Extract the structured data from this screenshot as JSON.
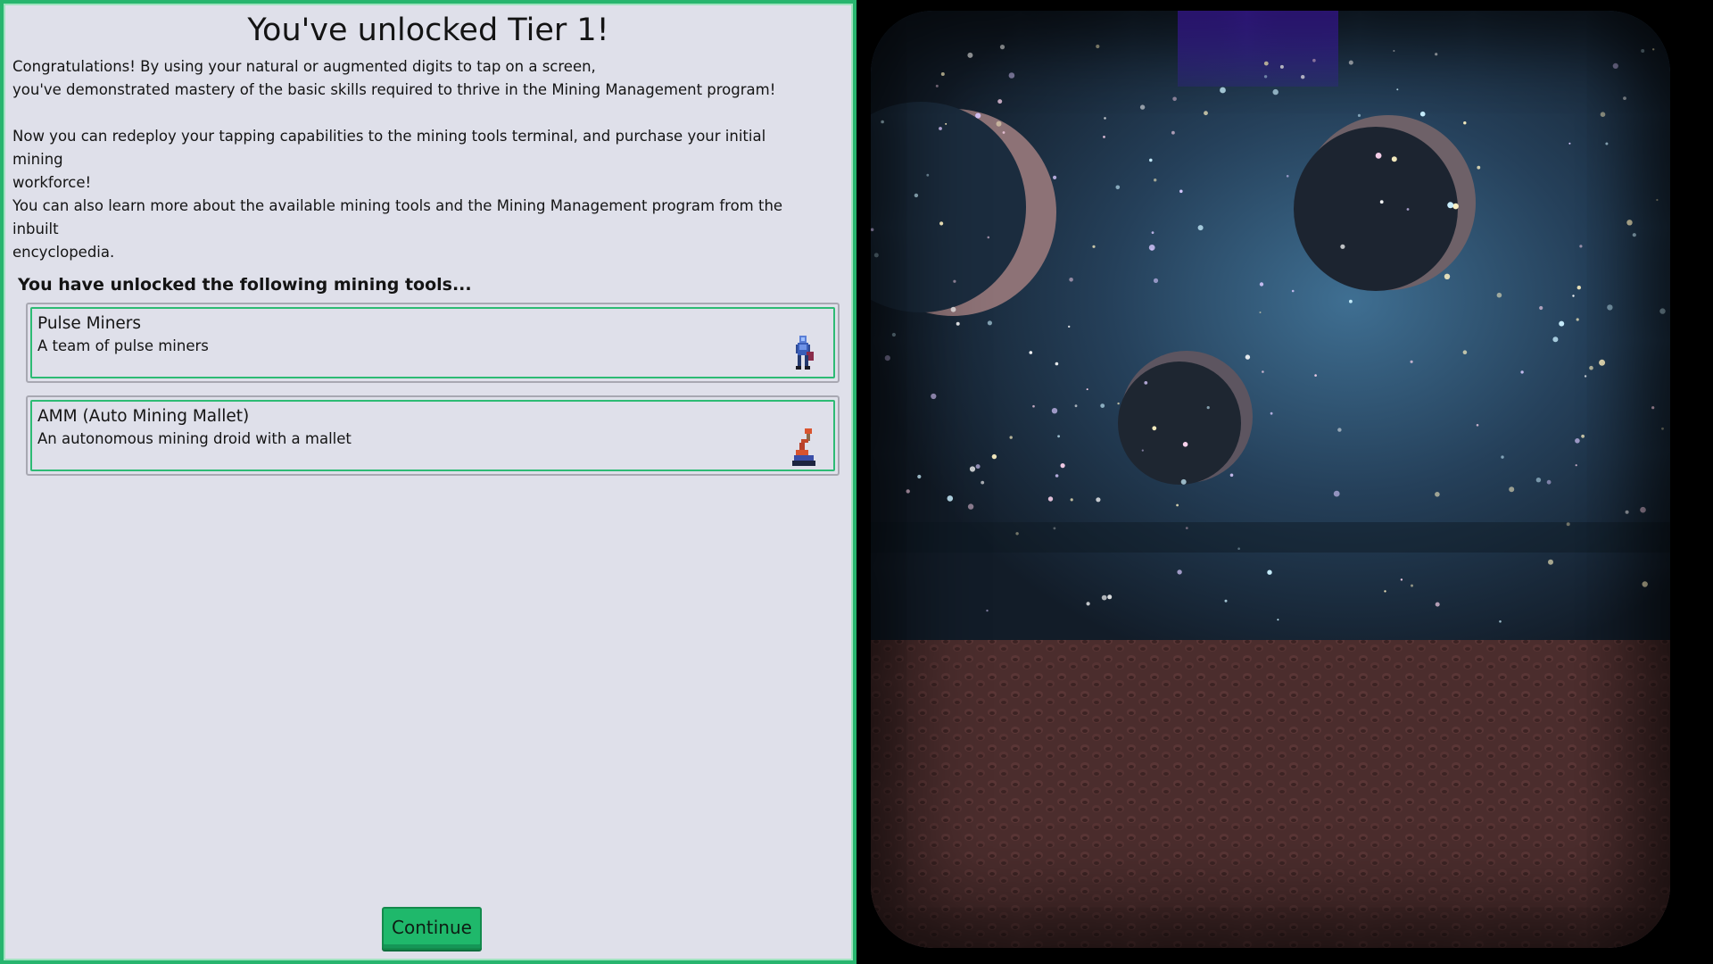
{
  "dialog": {
    "title": "You've unlocked Tier 1!",
    "paragraph_1": [
      "Congratulations! By using your natural or augmented digits to tap on a screen,",
      "you've demonstrated mastery of the basic skills required to thrive in the Mining Management program!"
    ],
    "paragraph_2": [
      "Now you can redeploy your tapping capabilities to the mining tools terminal, and purchase your initial mining",
      "workforce!"
    ],
    "paragraph_3": [
      "You can also learn more about the available mining tools and the Mining Management program from the inbuilt",
      "encyclopedia."
    ],
    "tools_heading": "You have unlocked the following mining tools...",
    "tools": [
      {
        "name": "Pulse Miners",
        "description": "A team of pulse miners",
        "icon": "pulse-miner-icon"
      },
      {
        "name": "AMM (Auto Mining Mallet)",
        "description": "An autonomous mining droid with a mallet",
        "icon": "mining-droid-icon"
      }
    ],
    "continue_label": "Continue"
  },
  "colors": {
    "panel_background": "#dfe0ea",
    "accent_green": "#27b56e",
    "button_green": "#1fb86b",
    "space_blue": "#1b2c3e",
    "ground_red": "#5a3535",
    "beam_purple": "#5a2cf0"
  }
}
